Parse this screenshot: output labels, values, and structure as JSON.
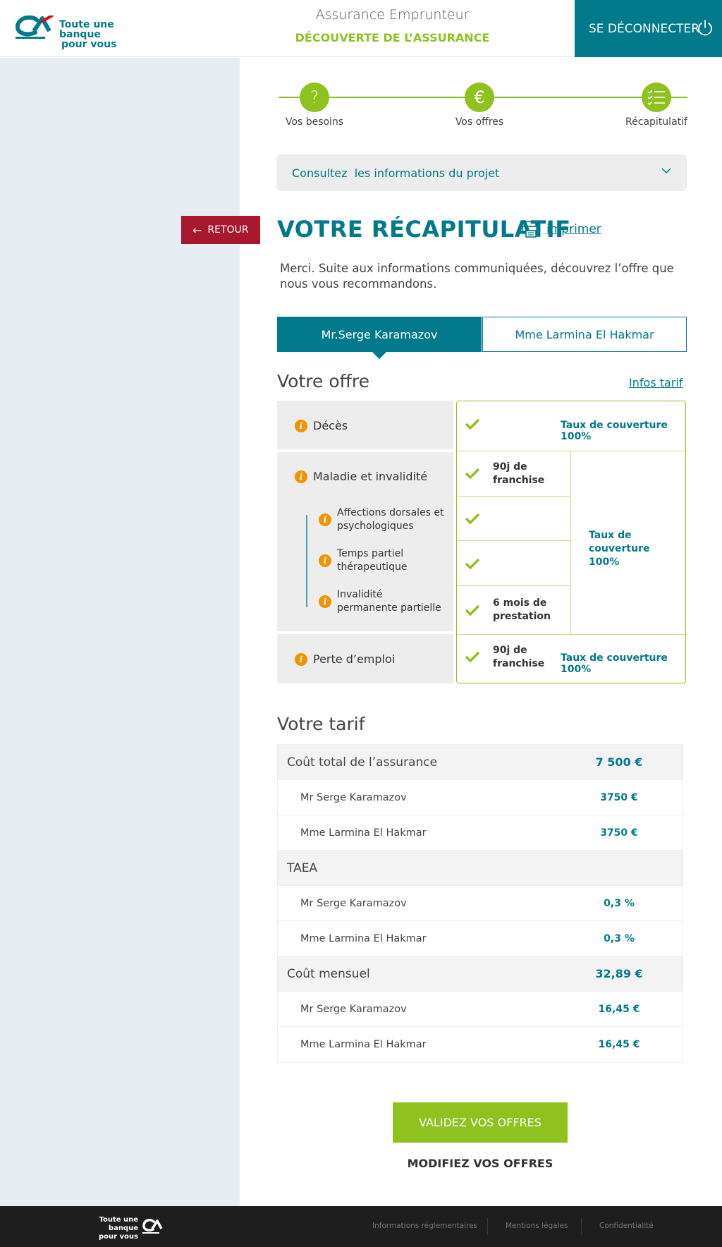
{
  "header": {
    "logo_line1": "Toute une banque",
    "logo_line2": "pour vous",
    "subtitle": "Assurance Emprunteur",
    "title": "DÉCOUVERTE DE L’ASSURANCE",
    "logout_label": "SE DÉCONNECTER"
  },
  "stepper": {
    "steps": [
      {
        "label": "Vos besoins",
        "icon": "question-icon",
        "glyph": "?"
      },
      {
        "label": "Vos offres",
        "icon": "euro-icon",
        "glyph": "€"
      },
      {
        "label": "Récapitulatif",
        "icon": "checklist-icon"
      }
    ]
  },
  "project_bar": {
    "label": "Consultez  les informations du projet"
  },
  "back_label": "RETOUR",
  "page_title": "VOTRE RÉCAPITULATIF",
  "print_label": "imprimer",
  "intro": "Merci. Suite aux informations communiquées, découvrez l’offre que nous vous recommandons.",
  "tabs": [
    "Mr.Serge Karamazov",
    "Mme Larmina El Hakmar"
  ],
  "offer": {
    "title": "Votre offre",
    "infos_tarif": "Infos tarif",
    "guarantees": {
      "deces": "Décès",
      "maladie": "Maladie et invalidité",
      "affections": "Affections dorsales et psychologiques",
      "temps_partiel": "Temps partiel thérapeutique",
      "invalidite": "Invalidité permanente partielle",
      "perte": "Perte d’emploi"
    },
    "coverage": {
      "deces_rate": "Taux de couverture 100%",
      "maladie_franchise": "90j de franchise",
      "invalidite_prestation": "6 mois de prestation",
      "maladie_rate": "Taux de couverture 100%",
      "perte_franchise": "90j de franchise",
      "perte_rate": "Taux de couverture 100%"
    }
  },
  "tarif": {
    "title": "Votre tarif",
    "rows": [
      {
        "type": "head",
        "label": "Coût total de l’assurance",
        "value": "7 500 €"
      },
      {
        "type": "sub",
        "label": "Mr Serge Karamazov",
        "value": "3750 €"
      },
      {
        "type": "sub",
        "label": "Mme Larmina El Hakmar",
        "value": "3750 €"
      },
      {
        "type": "head",
        "label": "TAEA",
        "value": ""
      },
      {
        "type": "sub",
        "label": "Mr Serge Karamazov",
        "value": "0,3 %"
      },
      {
        "type": "sub",
        "label": "Mme Larmina El Hakmar",
        "value": "0,3 %"
      },
      {
        "type": "head",
        "label": "Coût mensuel",
        "value": "32,89 €"
      },
      {
        "type": "sub",
        "label": "Mr Serge Karamazov",
        "value": "16,45 €"
      },
      {
        "type": "sub",
        "label": "Mme Larmina El Hakmar",
        "value": "16,45 €"
      }
    ]
  },
  "actions": {
    "validate": "VALIDEZ VOS OFFRES",
    "modify": "MODIFIEZ VOS OFFRES"
  },
  "footer": {
    "logo_line1": "Toute une banque",
    "logo_line2": "pour vous",
    "links": [
      "Informations réglementaires",
      "Mentions légales",
      "Confidentialité"
    ]
  },
  "colors": {
    "teal": "#007a8a",
    "green": "#8dc21f",
    "red": "#a8182d",
    "orange": "#f39200"
  }
}
